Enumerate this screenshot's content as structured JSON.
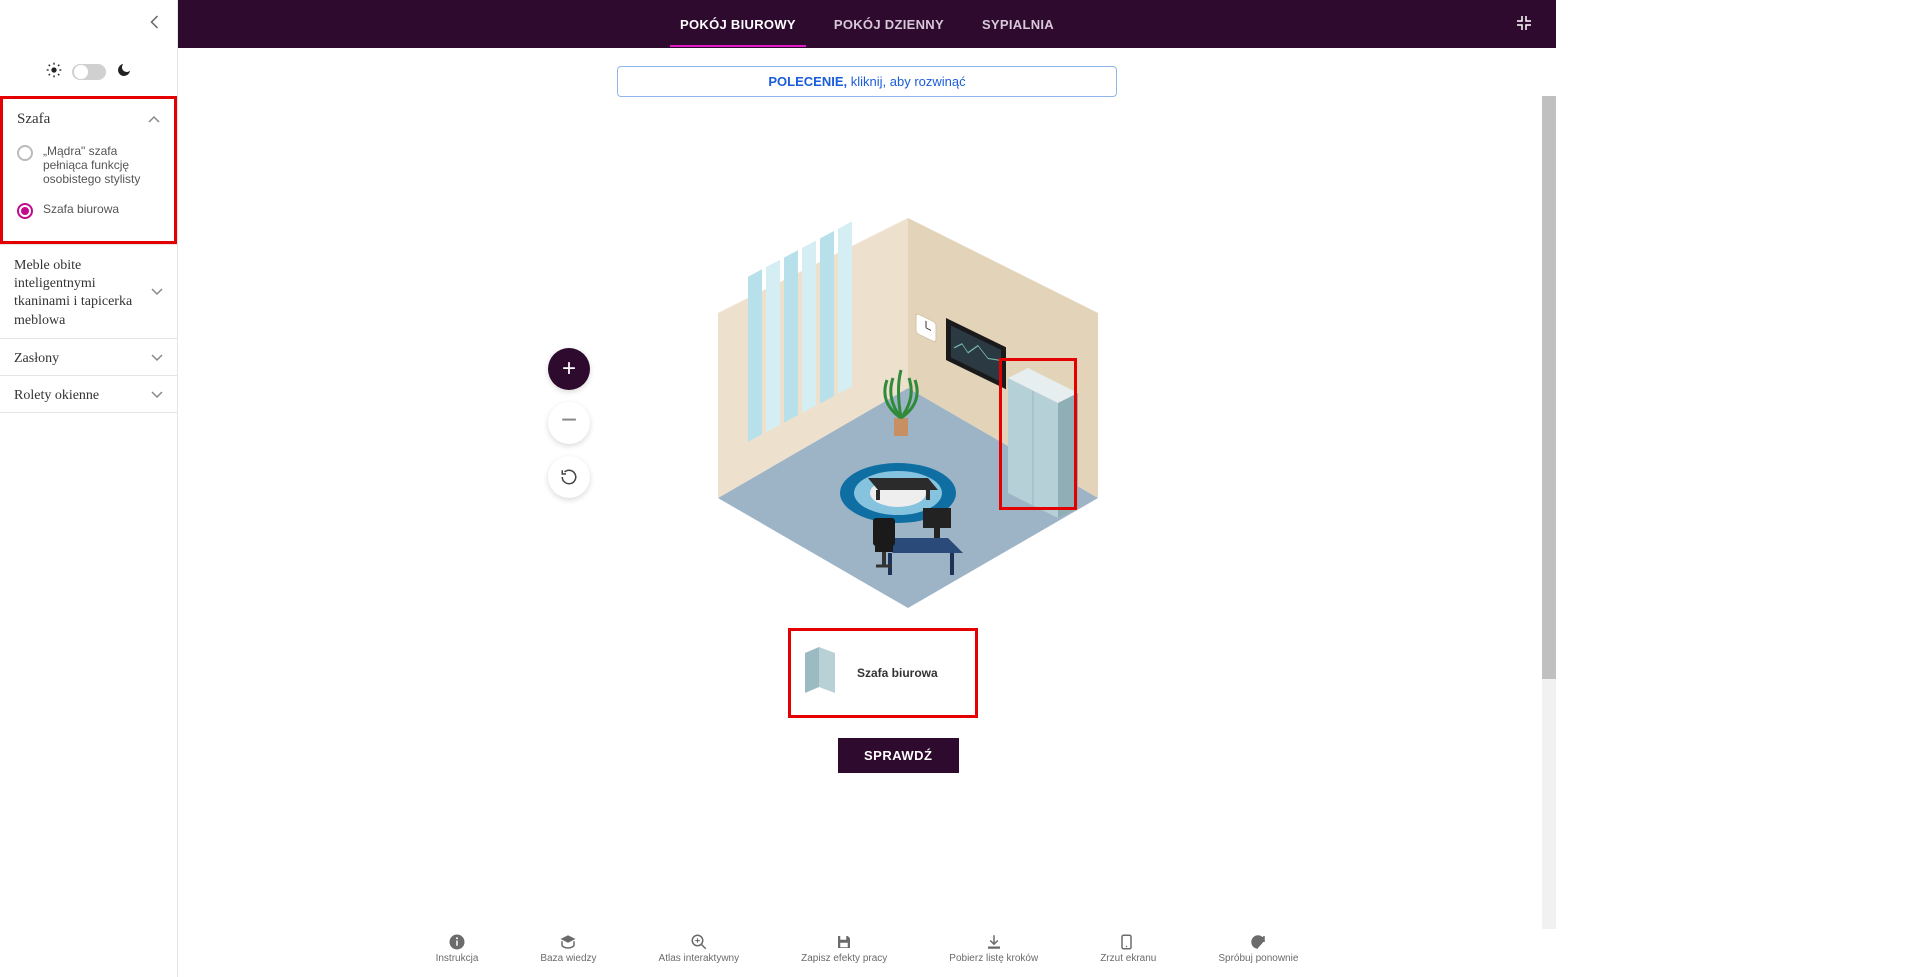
{
  "tabs": {
    "active": "POKÓJ BIUROWY",
    "items": [
      "POKÓJ BIUROWY",
      "POKÓJ DZIENNY",
      "SYPIALNIA"
    ]
  },
  "command": {
    "bold": "POLECENIE,",
    "rest": " kliknij, aby rozwinąć"
  },
  "sidebar": {
    "expanded_section": "Szafa",
    "options": [
      {
        "label": "„Mądra\" szafa pełniąca funkcję osobistego stylisty",
        "selected": false
      },
      {
        "label": "Szafa biurowa",
        "selected": true
      }
    ],
    "collapsed": [
      "Meble obite inteligentnymi tkaninami i tapicerka meblowa",
      "Zasłony",
      "Rolety okienne"
    ]
  },
  "selected_item": {
    "label": "Szafa biurowa"
  },
  "check_button": "SPRAWDŹ",
  "toolbar": [
    "Instrukcja",
    "Baza wiedzy",
    "Atlas interaktywny",
    "Zapisz efekty pracy",
    "Pobierz listę kroków",
    "Zrzut ekranu",
    "Spróbuj ponownie"
  ],
  "icons": {
    "sun": "sun-icon",
    "moon": "moon-icon",
    "collapse": "chevron-left-icon",
    "chevron_up": "chevron-up-icon",
    "chevron_down": "chevron-down-icon",
    "plus": "plus-icon",
    "minus": "minus-icon",
    "reset": "reset-rotation-icon",
    "fullscreen": "fullscreen-exit-icon"
  }
}
